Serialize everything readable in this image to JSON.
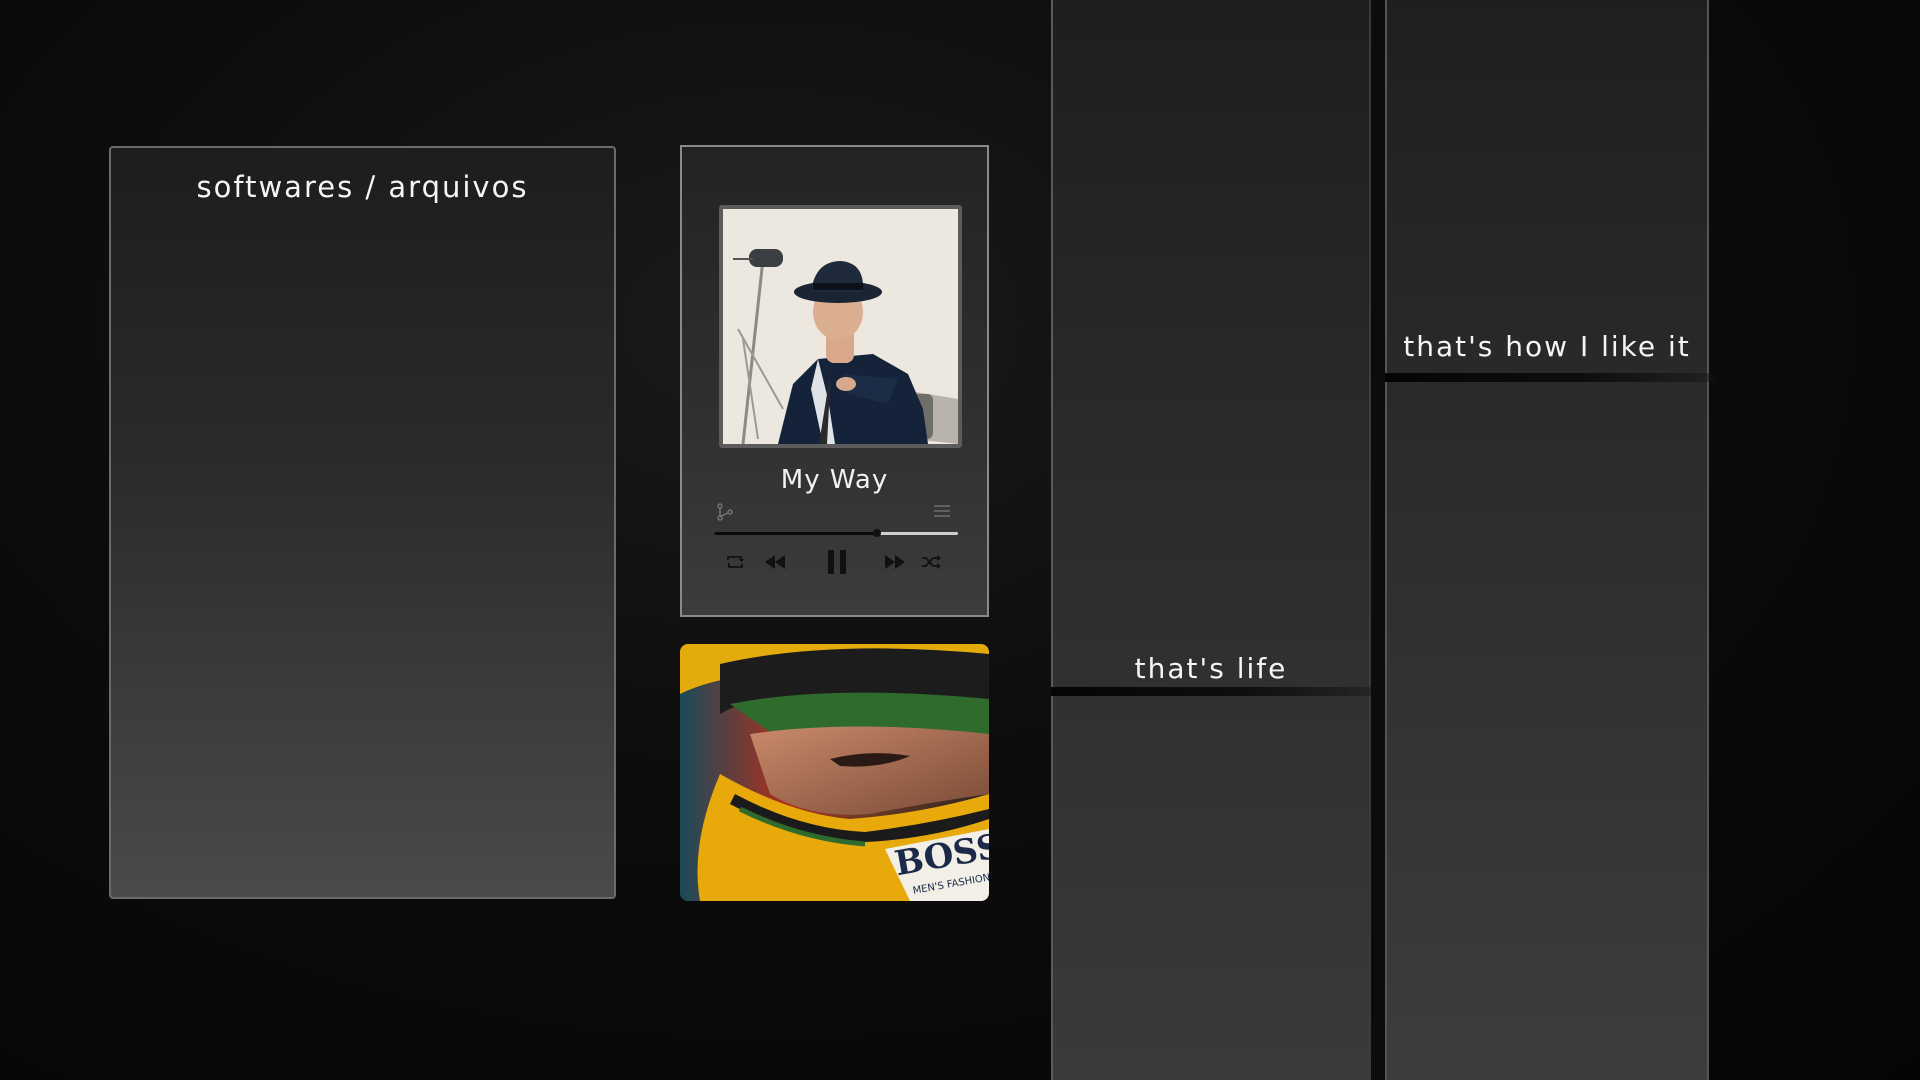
{
  "files_panel": {
    "title": "softwares / arquivos"
  },
  "player": {
    "song_title": "My Way",
    "progress": 0.67,
    "icons": {
      "share": "share-icon",
      "queue": "queue-icon",
      "repeat": "repeat-icon",
      "previous": "rewind-icon",
      "pause": "pause-icon",
      "next": "fast-forward-icon",
      "shuffle": "shuffle-icon"
    }
  },
  "photo": {
    "helmet_text": "BOSS",
    "helmet_subtext": "MEN'S FASHION"
  },
  "columns": [
    {
      "caption": "that's life"
    },
    {
      "caption": "that's how I like it"
    }
  ],
  "colors": {
    "accent_yellow": "#e0a400",
    "accent_green": "#2e6b2c"
  }
}
